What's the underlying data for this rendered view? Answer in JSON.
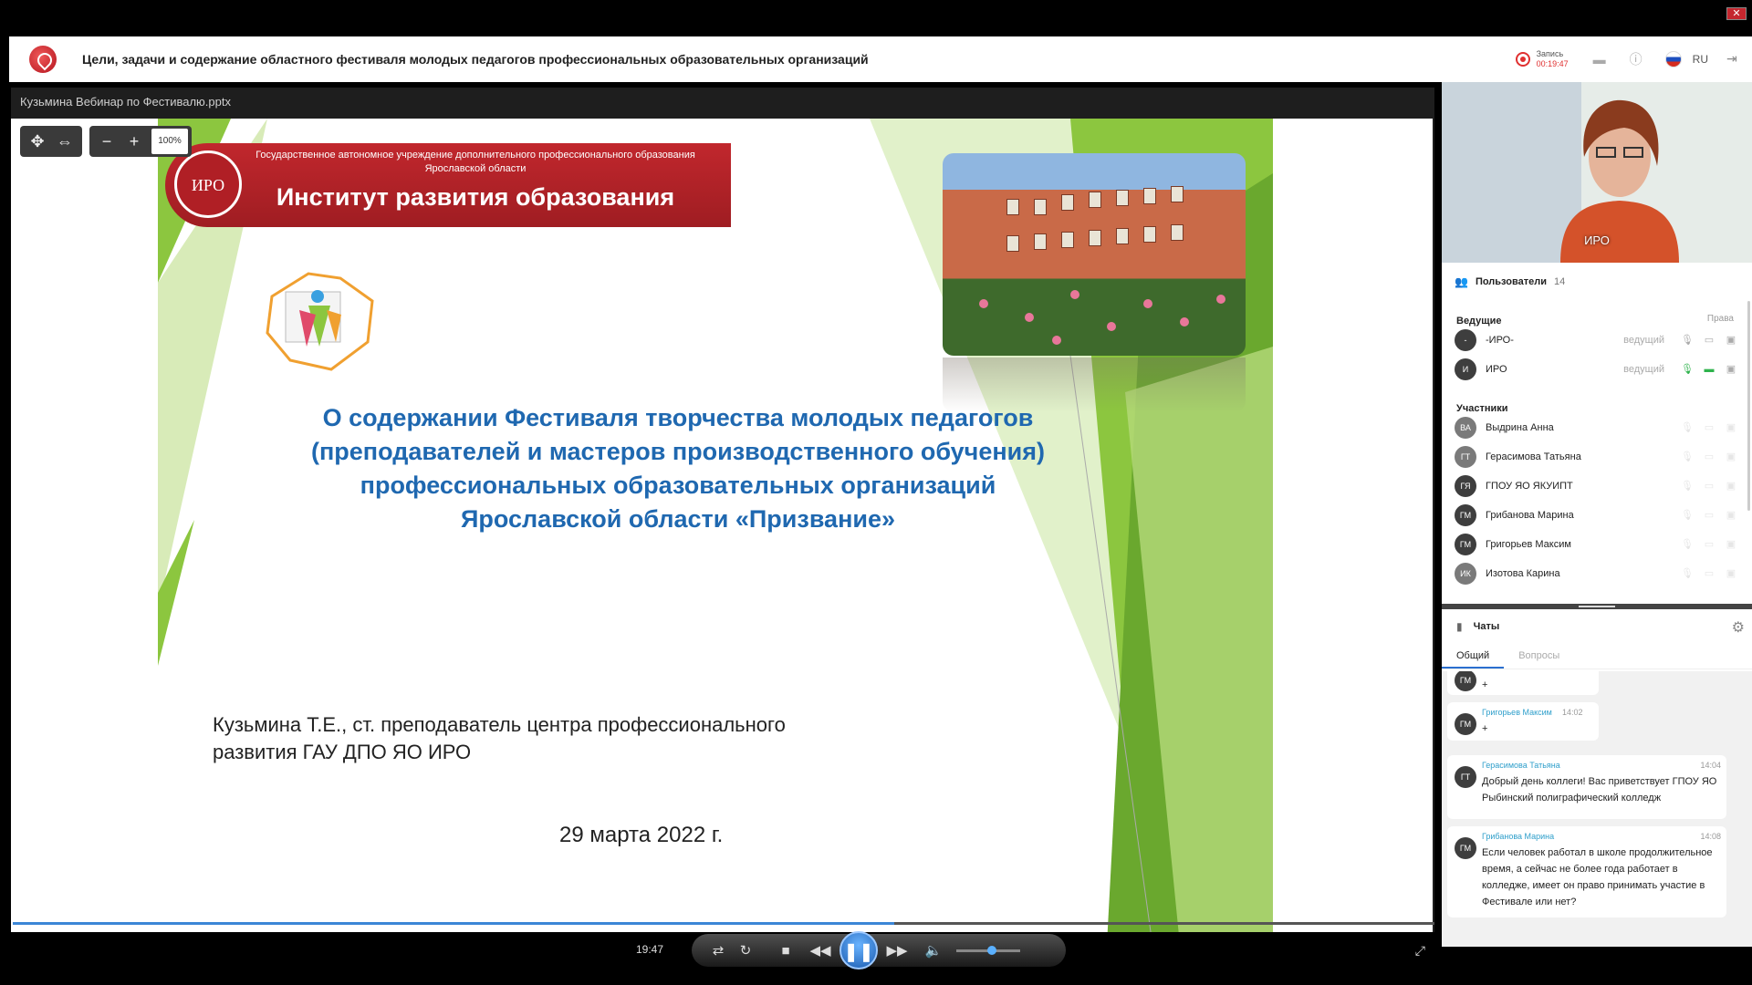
{
  "header": {
    "title": "Цели, задачи и содержание областного фестиваля молодых педагогов профессиональных образовательных организаций",
    "record_label": "Запись",
    "record_time": "00:19:47",
    "lang": "RU"
  },
  "presentation": {
    "file_title": "Кузьмина Вебинар по Фестивалю.pptx",
    "zoom": "100%"
  },
  "slide": {
    "org_sub": "Государственное автономное учреждение дополнительного профессионального образования Ярославской области",
    "org_main": "Институт развития образования",
    "logo_text": "ИРО",
    "title": "О  содержании Фестиваля творчества молодых педагогов (преподавателей и мастеров производственного обучения) профессиональных образовательных организаций Ярославской области «Призвание»",
    "author": "Кузьмина Т.Е., ст. преподаватель центра профессионального развития ГАУ ДПО ЯО ИРО",
    "date": "29 марта 2022 г."
  },
  "player": {
    "time": "19:47",
    "progress": 0.62,
    "volume": 0.55
  },
  "video": {
    "name": "ИРО"
  },
  "users": {
    "label": "Пользователи",
    "count": "14",
    "hosts_label": "Ведущие",
    "rights_label": "Права",
    "hosts": [
      {
        "initials": "-",
        "name": "-ИРО-",
        "role": "ведущий"
      },
      {
        "initials": "И",
        "name": "ИРО",
        "role": "ведущий"
      }
    ],
    "participants_label": "Участники",
    "participants": [
      {
        "initials": "ВА",
        "name": "Выдрина Анна"
      },
      {
        "initials": "ГТ",
        "name": "Герасимова Татьяна"
      },
      {
        "initials": "ГЯ",
        "name": "ГПОУ ЯО ЯКУИПТ"
      },
      {
        "initials": "ГМ",
        "name": "Грибанова Марина"
      },
      {
        "initials": "ГМ",
        "name": "Григорьев Максим"
      },
      {
        "initials": "ИК",
        "name": "Изотова Карина"
      }
    ]
  },
  "chat": {
    "label": "Чаты",
    "tabs": [
      "Общий",
      "Вопросы"
    ],
    "messages": [
      {
        "initials": "ГМ",
        "author": "",
        "time": "",
        "text": "+"
      },
      {
        "initials": "ГМ",
        "author": "Григорьев Максим",
        "time": "14:02",
        "text": "+"
      },
      {
        "initials": "ГТ",
        "author": "Герасимова Татьяна",
        "time": "14:04",
        "text": "Добрый день коллеги! Вас приветствует ГПОУ ЯО Рыбинский полиграфический колледж"
      },
      {
        "initials": "ГМ",
        "author": "Грибанова Марина",
        "time": "14:08",
        "text": "Если человек работал в школе продолжительное время, а сейчас не более года работает в колледже, имеет он право принимать участие в Фестивале или нет?"
      }
    ]
  },
  "colors": {
    "accent_blue": "#1f68b0",
    "banner_red": "#c1272d",
    "slide_green": "#8cc63f"
  }
}
